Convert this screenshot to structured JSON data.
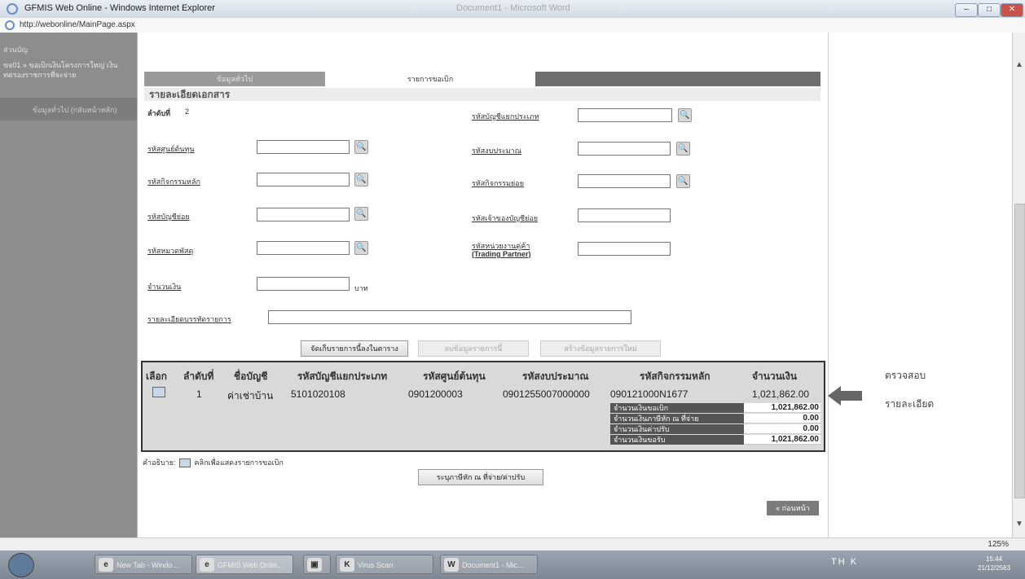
{
  "window": {
    "title": "GFMIS Web Online - Windows Internet Explorer",
    "faded_title": "Document1 - Microsoft Word",
    "url": "http://webonline/MainPage.aspx",
    "buttons": [
      "–",
      "□",
      "✕"
    ]
  },
  "sidebar": {
    "title": "ส่วนบัญ",
    "menu": "ขจ01 » ขอเบิกเงินโครงการใหญ่ เงินทดรองราชการที่จะจ่าย",
    "sub": "ข้อมูลทั่วไป (กลับหน้าหลัก)"
  },
  "tabs": [
    "ข้อมูลทั่วไป",
    "รายการขอเบิก"
  ],
  "section_title": "รายละเอียดเอกสาร",
  "form": {
    "seq_label": "ลำดับที่",
    "seq_value": "2",
    "gl_label": "รหัสบัญชีแยกประเภท",
    "cost_center_label": "รหัสศูนย์ต้นทุน",
    "budget_label": "รหัสงบประมาณ",
    "main_activity_label": "รหัสกิจกรรมหลัก",
    "sub_activity_label": "รหัสกิจกรรมย่อย",
    "subaccount_label": "รหัสบัญชีย่อย",
    "subaccount_owner_label": "รหัสเจ้าของบัญชีย่อย",
    "material_group_label": "รหัสหมวดพัสดุ",
    "trading_partner_label": "รหัสหน่วยงานคู่ค้า",
    "trading_partner_en": "(Trading Partner)",
    "amount_label": "จำนวนเงิน",
    "amount_unit": "บาท",
    "description_label": "รายละเอียดบรรทัดรายการ"
  },
  "buttons": {
    "save_to_table": "จัดเก็บรายการนี้ลงในตาราง",
    "clear": "ลบข้อมูลรายการนี้",
    "new": "สร้างข้อมูลรายการใหม่",
    "withholding": "ระบุภาษีหัก ณ ที่จ่าย/ค่าปรับ",
    "back": "« ก่อนหน้า"
  },
  "table": {
    "headers": [
      "เลือก",
      "ลำดับที่",
      "ชื่อบัญชี",
      "รหัสบัญชีแยกประเภท",
      "รหัสศูนย์ต้นทุน",
      "รหัสงบประมาณ",
      "รหัสกิจกรรมหลัก",
      "จำนวนเงิน"
    ],
    "row": {
      "seq": "1",
      "account_name": "ค่าเช่าบ้าน",
      "gl": "5101020108",
      "cost_center": "0901200003",
      "budget": "0901255007000000",
      "activity": "090121000N1677",
      "amount": "1,021,862.00"
    },
    "summary": [
      {
        "label": "จำนวนเงินขอเบิก",
        "value": "1,021,862.00"
      },
      {
        "label": "จำนวนเงินภาษีหัก ณ ที่จ่าย",
        "value": "0.00"
      },
      {
        "label": "จำนวนเงินค่าปรับ",
        "value": "0.00"
      },
      {
        "label": "จำนวนเงินขอรับ",
        "value": "1,021,862.00"
      }
    ]
  },
  "legend": {
    "prefix": "คำอธิบาย:",
    "text": "คลิกเพื่อแสดงรายการขอเบิก"
  },
  "annotation": {
    "line1": "ตรวจสอบ",
    "line2": "รายละเอียด"
  },
  "status": {
    "zoom": "125%"
  },
  "taskbar": {
    "items": [
      "New Tab - Windo...",
      "GFMIS Web Onlin...",
      "",
      "Virus Scan",
      "Document1 - Mic..."
    ],
    "clock_time": "15:44",
    "clock_date": "21/12/2563",
    "tray": "TH K"
  }
}
